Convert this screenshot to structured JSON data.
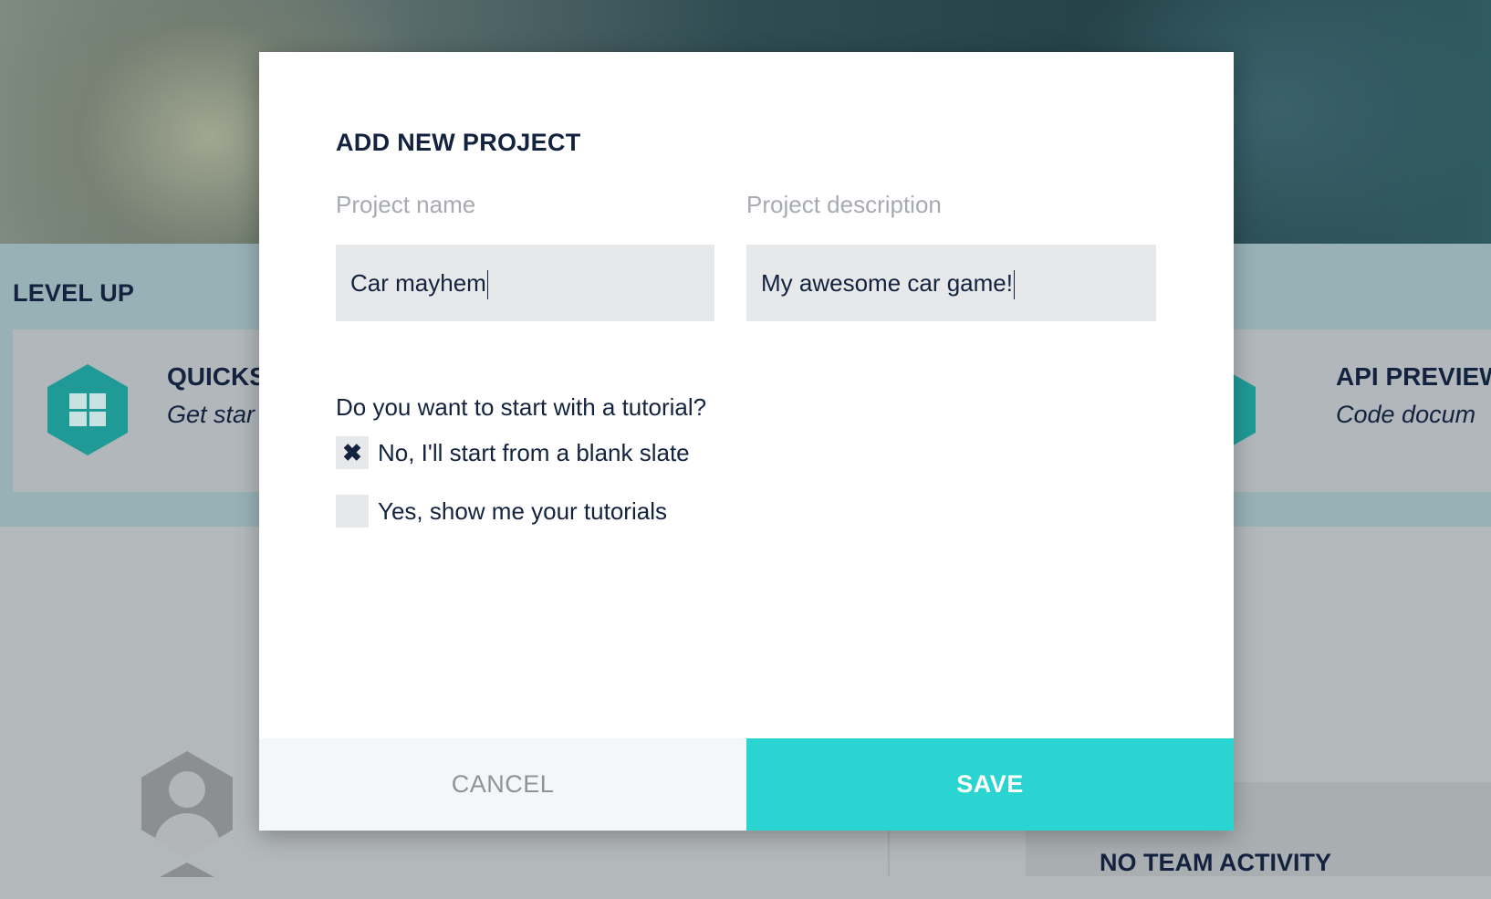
{
  "background": {
    "level_up_title": "LEVEL UP",
    "cards": [
      {
        "title": "QUICKS",
        "subtitle": "Get star",
        "icon": "windows-icon"
      },
      {
        "title": "API PREVIEW",
        "subtitle": "Code docum",
        "icon": "windows-icon"
      }
    ],
    "team_activity_title": "NO TEAM ACTIVITY"
  },
  "modal": {
    "title": "ADD NEW PROJECT",
    "name_label": "Project name",
    "name_value": "Car mayhem",
    "description_label": "Project description",
    "description_value": "My awesome car game!",
    "tutorial_question": "Do you want to start with a tutorial?",
    "options": [
      {
        "label": "No, I'll start from a blank slate",
        "checked": true,
        "mark": "✖"
      },
      {
        "label": "Yes, show me your tutorials",
        "checked": false,
        "mark": ""
      }
    ],
    "cancel_label": "CANCEL",
    "save_label": "SAVE"
  },
  "colors": {
    "accent": "#2ad4d1",
    "text": "#13233f",
    "hex_icon": "#1f9a96"
  }
}
